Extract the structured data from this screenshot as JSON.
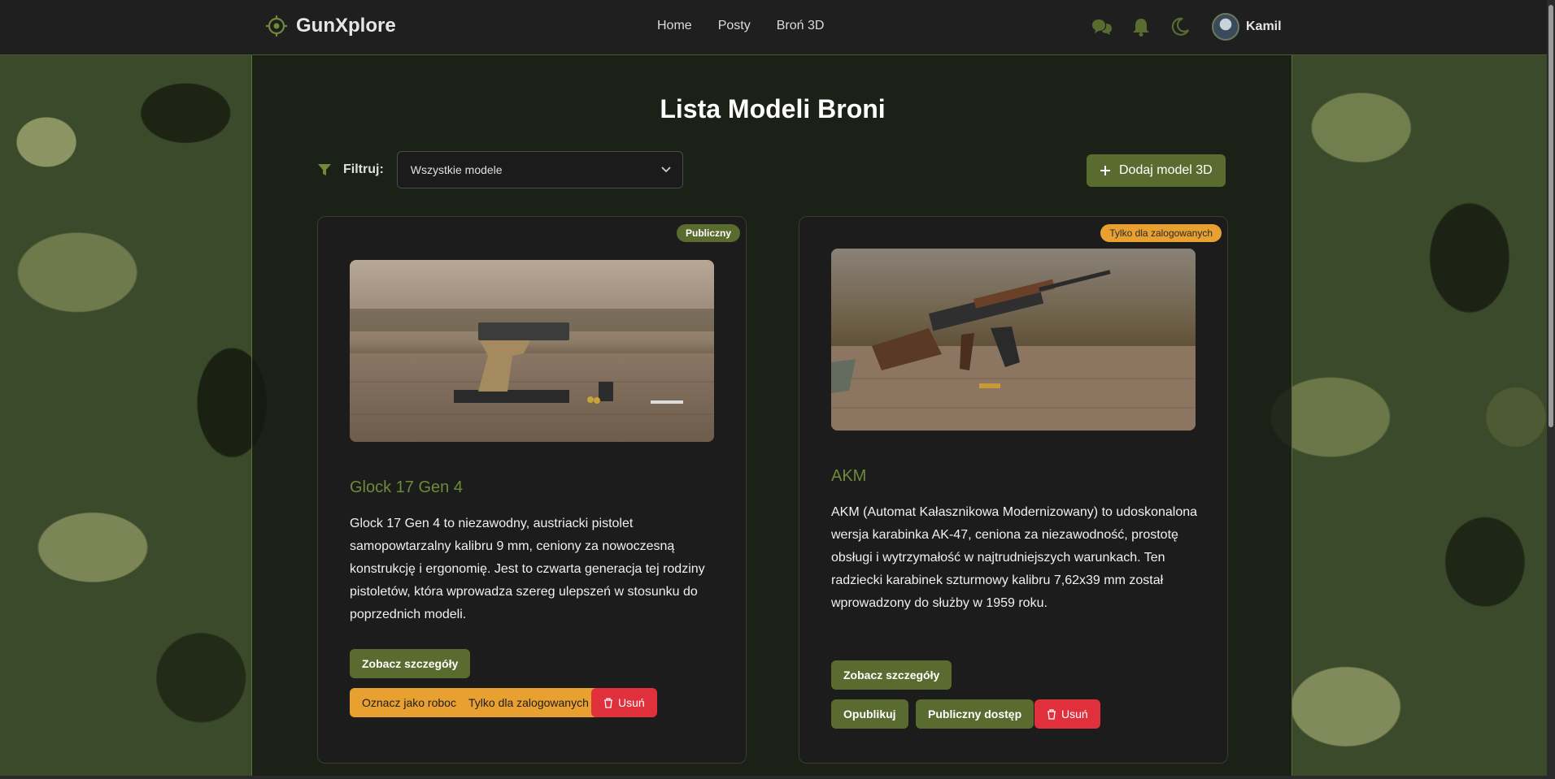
{
  "nav": {
    "brand": "GunXplore",
    "links": [
      "Home",
      "Posty",
      "Broń 3D"
    ],
    "icons": [
      "chat-icon",
      "bell-icon",
      "moon-icon"
    ],
    "user_name": "Kamil"
  },
  "page": {
    "title": "Lista Modeli Broni",
    "filter_label": "Filtruj:",
    "filter_value": "Wszystkie modele",
    "add_button": "Dodaj model 3D"
  },
  "cards": [
    {
      "badge": "Publiczny",
      "title": "Glock 17 Gen 4",
      "description": "Glock 17 Gen 4 to niezawodny, austriacki pistolet samopowtarzalny kalibru 9 mm, ceniony za nowoczesną konstrukcję i ergonomię. Jest to czwarta generacja tej rodziny pistoletów, która wprowadza szereg ulepszeń w stosunku do poprzednich modeli.",
      "details_button": "Zobacz szczegóły",
      "actions": [
        "Oznacz jako roboczy",
        "Tylko dla zalogowanych",
        "Usuń"
      ]
    },
    {
      "badge": "Tylko dla zalogowanych",
      "title": "AKM",
      "description": "AKM (Automat Kałasznikowa Modernizowany) to udoskonalona wersja karabinka AK-47, ceniona za niezawodność, prostotę obsługi i wytrzymałość w najtrudniejszych warunkach. Ten radziecki karabinek szturmowy kalibru 7,62x39 mm został wprowadzony do służby w 1959 roku.",
      "details_button": "Zobacz szczegóły",
      "actions": [
        "Opublikuj",
        "Publiczny dostęp",
        "Usuń"
      ]
    }
  ],
  "colors": {
    "accent_green": "#5a6b30",
    "title_green": "#6f8a3a",
    "orange": "#e8a030",
    "red": "#e0303c"
  }
}
